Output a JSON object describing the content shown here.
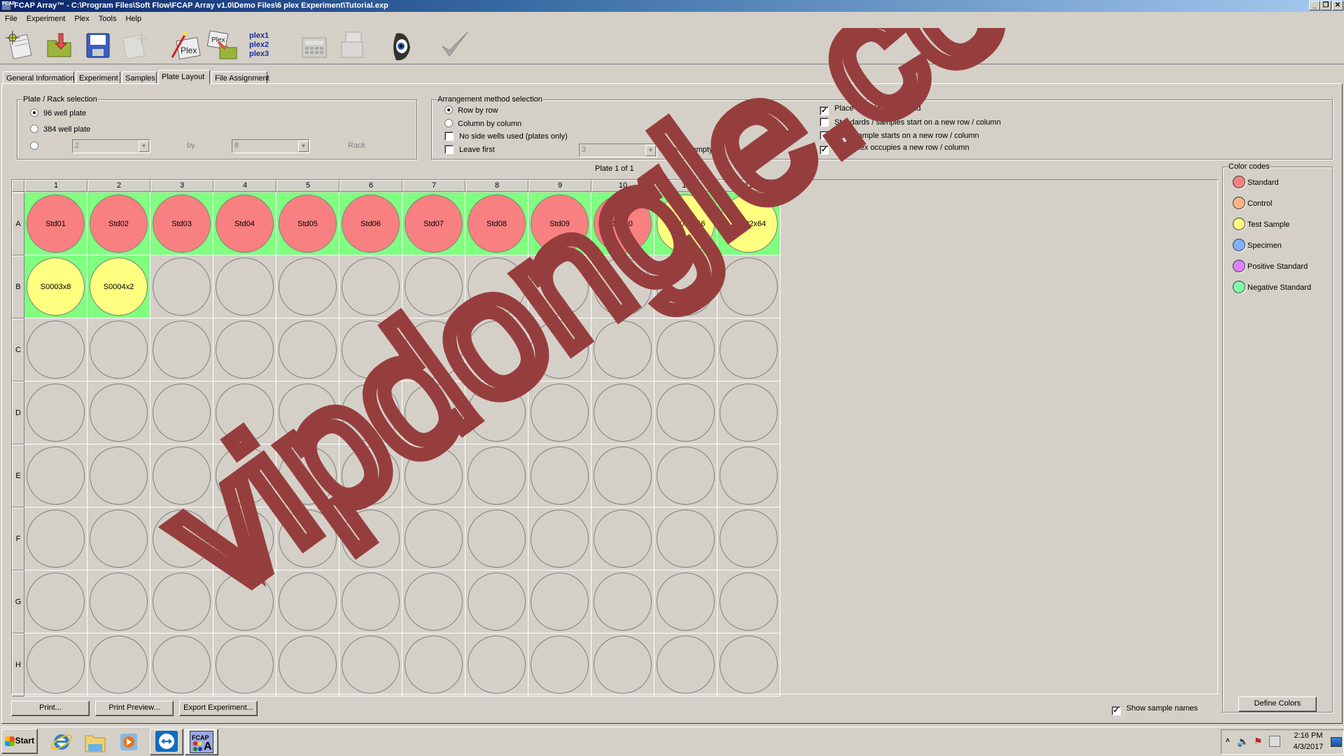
{
  "window": {
    "title": "FCAP Array™ - C:\\Program Files\\Soft Flow\\FCAP Array v1.0\\Demo Files\\6 plex Experiment\\Tutorial.exp",
    "app_icon": "FCAP",
    "controls": {
      "minimize": "_",
      "restore": "❐",
      "close": "✕"
    }
  },
  "menu": [
    "File",
    "Experiment",
    "Plex",
    "Tools",
    "Help"
  ],
  "toolbar": [
    {
      "name": "new-experiment-icon"
    },
    {
      "name": "open-folder-icon"
    },
    {
      "name": "save-disk-icon"
    },
    {
      "name": "disabled-new-icon"
    },
    {
      "name": "plex-wizard-icon",
      "label": "Plex"
    },
    {
      "name": "plex-open-icon",
      "label": "Plex"
    },
    {
      "name": "plex-list-icon",
      "lines": [
        "plex1",
        "plex2",
        "plex3"
      ]
    },
    {
      "name": "calculator-icon"
    },
    {
      "name": "documents-icon"
    },
    {
      "name": "eye-icon"
    },
    {
      "name": "checkmark-icon"
    }
  ],
  "tabs": [
    {
      "label": "General Information",
      "active": false
    },
    {
      "label": "Experiment",
      "active": false
    },
    {
      "label": "Samples",
      "active": false
    },
    {
      "label": "Plate Layout",
      "active": true
    },
    {
      "label": "File Assignment",
      "active": false
    }
  ],
  "plate_rack": {
    "legend": "Plate / Rack selection",
    "options": [
      {
        "label": "96 well plate",
        "selected": true
      },
      {
        "label": "384 well plate",
        "selected": false
      }
    ],
    "rack_option_selected": false,
    "rack_rows": "2",
    "by_label": "by",
    "rack_cols": "8",
    "rack_label": "Rack"
  },
  "arrangement": {
    "legend": "Arrangement method selection",
    "radios": [
      {
        "label": "Row by row",
        "selected": true
      },
      {
        "label": "Column by column",
        "selected": false
      }
    ],
    "checks": [
      {
        "label": "No side wells used (plates only)",
        "checked": false
      },
      {
        "label": "Leave first",
        "checked": false
      }
    ],
    "leave_first_value": "3",
    "wells_empty_label": "wells empty",
    "right_checks": [
      {
        "label": "Place samples at the end",
        "checked": true
      },
      {
        "label": "Standards / samples start on a new row / column",
        "checked": false
      },
      {
        "label": "Each sample starts on a new row / column",
        "checked": false
      },
      {
        "label": "Each plex occupies a new row / column",
        "checked": true
      }
    ]
  },
  "plate": {
    "title": "Plate 1 of 1",
    "columns": [
      "1",
      "2",
      "3",
      "4",
      "5",
      "6",
      "7",
      "8",
      "9",
      "10",
      "11",
      "12"
    ],
    "rows": [
      "A",
      "B",
      "C",
      "D",
      "E",
      "F",
      "G",
      "H"
    ],
    "wells": {
      "A": [
        {
          "name": "Std01",
          "type": "standard"
        },
        {
          "name": "Std02",
          "type": "standard"
        },
        {
          "name": "Std03",
          "type": "standard"
        },
        {
          "name": "Std04",
          "type": "standard"
        },
        {
          "name": "Std05",
          "type": "standard"
        },
        {
          "name": "Std06",
          "type": "standard"
        },
        {
          "name": "Std07",
          "type": "standard"
        },
        {
          "name": "Std08",
          "type": "standard"
        },
        {
          "name": "Std09",
          "type": "standard"
        },
        {
          "name": "Std10",
          "type": "standard"
        },
        {
          "name": "S0001x256",
          "type": "test"
        },
        {
          "name": "S0002x64",
          "type": "test"
        }
      ],
      "B": [
        {
          "name": "S0003x8",
          "type": "test"
        },
        {
          "name": "S0004x2",
          "type": "test"
        }
      ]
    },
    "occupied_color": "#80ff80"
  },
  "color_codes": {
    "legend": "Color codes",
    "items": [
      {
        "label": "Standard",
        "key": "standard",
        "color": "#f88080"
      },
      {
        "label": "Control",
        "key": "control",
        "color": "#ffb380"
      },
      {
        "label": "Test Sample",
        "key": "test",
        "color": "#ffff80"
      },
      {
        "label": "Specimen",
        "key": "specimen",
        "color": "#80b0ff"
      },
      {
        "label": "Positive Standard",
        "key": "positive",
        "color": "#e080ff"
      },
      {
        "label": "Negative Standard",
        "key": "negative",
        "color": "#80ffa8"
      }
    ],
    "define_button": "Define Colors"
  },
  "bottom": {
    "print": "Print...",
    "print_preview": "Print Preview...",
    "export": "Export Experiment...",
    "show_names_label": "Show sample names",
    "show_names_checked": true
  },
  "taskbar": {
    "start": "Start",
    "apps": [
      "internet-explorer-icon",
      "file-explorer-icon",
      "media-player-icon",
      "teamviewer-icon",
      "fcap-array-icon"
    ],
    "fcap_label": "FCAP",
    "time": "2:16 PM",
    "date": "4/3/2017"
  },
  "watermark": "vipdongle.com"
}
